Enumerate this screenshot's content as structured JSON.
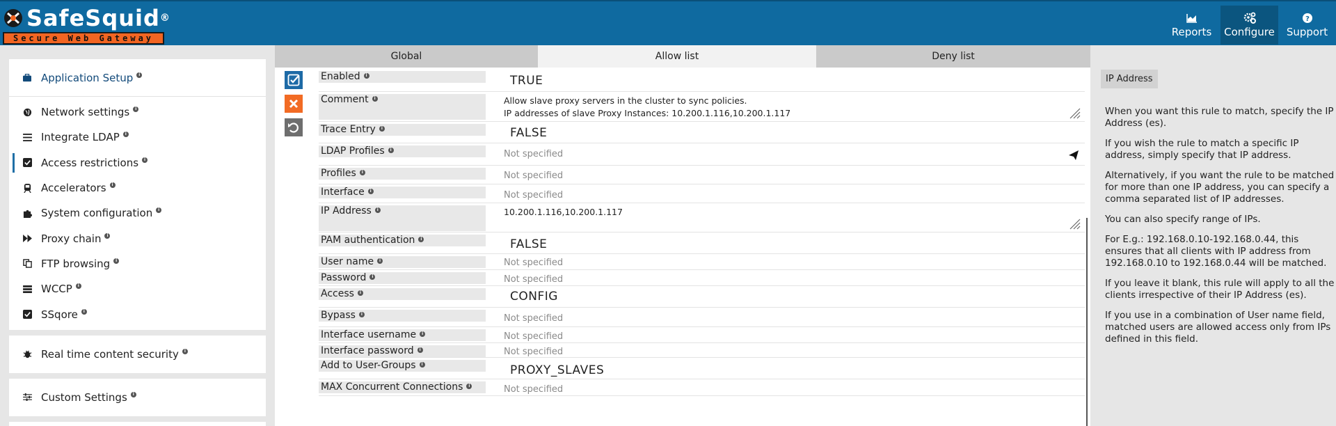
{
  "brand": {
    "name": "SafeSquid",
    "registered": "®",
    "tagline": "Secure Web Gateway",
    "accent": "#f26522",
    "header_color": "#0f6aa0"
  },
  "nav": [
    {
      "label": "Reports",
      "icon": "area-chart-icon"
    },
    {
      "label": "Configure",
      "icon": "gears-icon"
    },
    {
      "label": "Support",
      "icon": "question-circle-icon"
    }
  ],
  "sidebar": {
    "header": "Application Setup",
    "items": [
      {
        "label": "Network settings",
        "icon": "globe-icon"
      },
      {
        "label": "Integrate LDAP",
        "icon": "list-icon"
      },
      {
        "label": "Access restrictions",
        "icon": "checkbox-icon"
      },
      {
        "label": "Accelerators",
        "icon": "train-icon"
      },
      {
        "label": "System configuration",
        "icon": "puzzle-icon"
      },
      {
        "label": "Proxy chain",
        "icon": "fast-forward-icon"
      },
      {
        "label": "FTP browsing",
        "icon": "copy-icon"
      },
      {
        "label": "WCCP",
        "icon": "server-icon"
      },
      {
        "label": "SSqore",
        "icon": "checkbox-icon"
      }
    ],
    "realtime": "Real time content security",
    "custom": "Custom Settings"
  },
  "tabs": [
    "Global",
    "Allow list",
    "Deny list"
  ],
  "fields": {
    "enabled": {
      "label": "Enabled",
      "value": "TRUE"
    },
    "comment": {
      "label": "Comment",
      "line1": "Allow slave proxy servers in the cluster to sync policies.",
      "line2": "IP addresses of slave Proxy Instances: 10.200.1.116,10.200.1.117"
    },
    "trace": {
      "label": "Trace Entry",
      "value": "FALSE"
    },
    "ldap": {
      "label": "LDAP Profiles",
      "value": "Not specified"
    },
    "profiles": {
      "label": "Profiles",
      "value": "Not specified"
    },
    "interface": {
      "label": "Interface",
      "value": "Not specified"
    },
    "ip": {
      "label": "IP Address",
      "value": "10.200.1.116,10.200.1.117"
    },
    "pam": {
      "label": "PAM authentication",
      "value": "FALSE"
    },
    "username": {
      "label": "User name",
      "value": "Not specified"
    },
    "password": {
      "label": "Password",
      "value": "Not specified"
    },
    "access": {
      "label": "Access",
      "value": "CONFIG"
    },
    "bypass": {
      "label": "Bypass",
      "value": "Not specified"
    },
    "iface_user": {
      "label": "Interface username",
      "value": "Not specified"
    },
    "iface_pass": {
      "label": "Interface password",
      "value": "Not specified"
    },
    "groups": {
      "label": "Add to User-Groups",
      "value": "PROXY_SLAVES"
    },
    "maxconn": {
      "label": "MAX Concurrent Connections",
      "value": "Not specified"
    }
  },
  "help": {
    "title": "IP Address",
    "paragraphs": [
      "When you want this rule to match, specify the IP Address (es).",
      "If you wish the rule to match a specific IP address, simply specify that IP address.",
      "Alternatively, if you want the rule to be matched for more than one IP address, you can specify a comma separated list of IP addresses.",
      "You can also specify range of IPs.",
      "For E.g.: 192.168.0.10-192.168.0.44, this ensures that all clients with IP address from 192.168.0.10 to 192.168.0.44 will be matched.",
      "If you leave it blank, this rule will apply to all the clients irrespective of their IP Address (es).",
      "If you use in a combination of User name field, matched users are allowed access only from IPs defined in this field."
    ]
  }
}
